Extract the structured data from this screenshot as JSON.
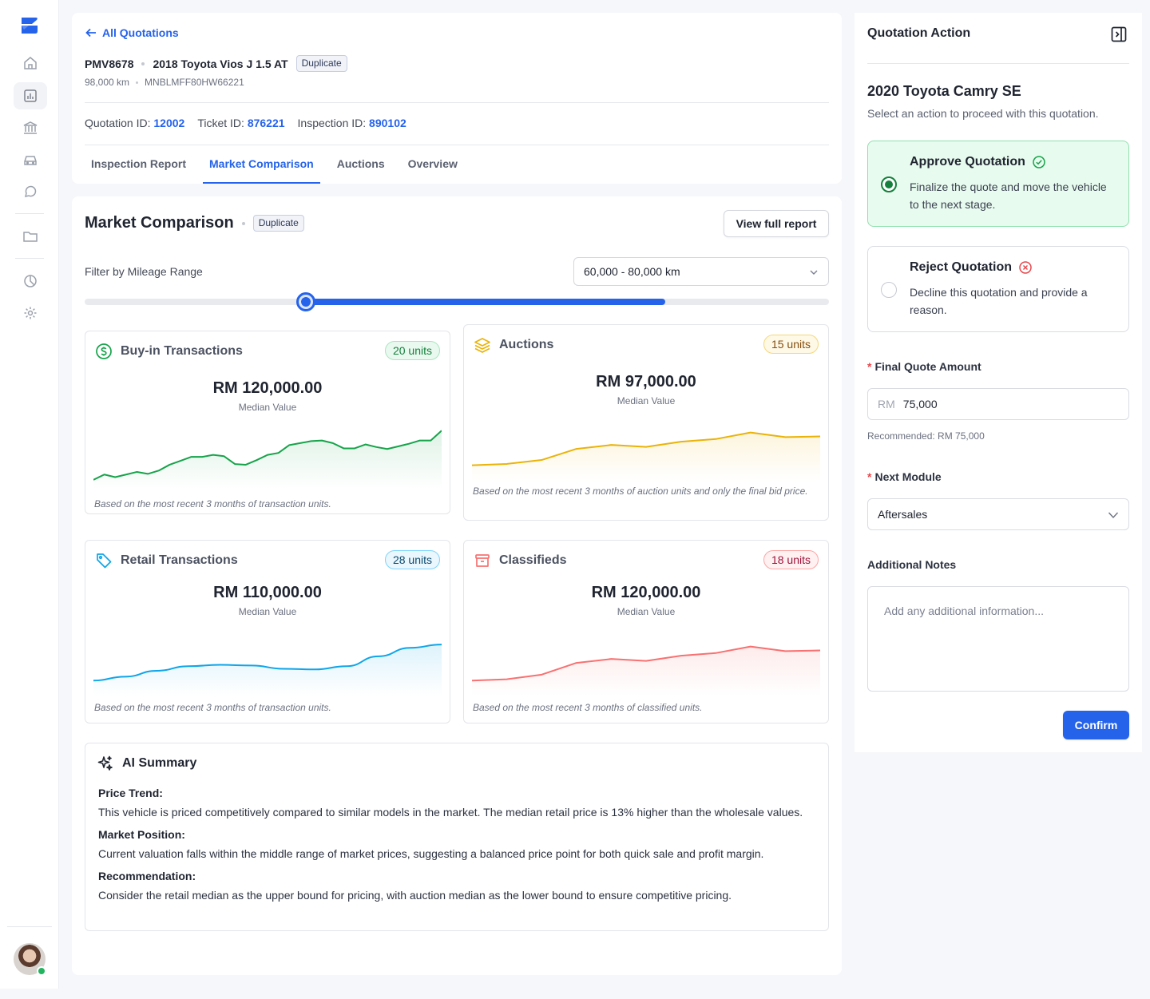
{
  "header": {
    "back_label": "All Quotations",
    "vehicle_code": "PMV8678",
    "vehicle_name": "2018 Toyota Vios J 1.5 AT",
    "badge": "Duplicate",
    "mileage": "98,000 km",
    "vin": "MNBLMFF80HW66221",
    "quotation_id_label": "Quotation ID:",
    "quotation_id": "12002",
    "ticket_id_label": "Ticket ID:",
    "ticket_id": "876221",
    "inspection_id_label": "Inspection ID:",
    "inspection_id": "890102",
    "tabs": [
      {
        "label": "Inspection Report"
      },
      {
        "label": "Market Comparison"
      },
      {
        "label": "Auctions"
      },
      {
        "label": "Overview"
      }
    ],
    "active_tab": "Market Comparison"
  },
  "market": {
    "title": "Market Comparison",
    "badge": "Duplicate",
    "report_button": "View full report",
    "filter_label": "Filter by Mileage Range",
    "mileage_selected": "60,000 - 80,000 km",
    "slider_range": {
      "start_fraction": 0.297,
      "end_fraction": 0.78
    },
    "cards": [
      {
        "title": "Buy-in Transactions",
        "units": "20 units",
        "value": "RM 120,000.00",
        "sub": "Median Value",
        "note": "Based on the most recent 3 months of transaction units.",
        "color": "#16a34a",
        "icon": "dollar-circle-icon",
        "series": [
          10,
          18,
          14,
          18,
          22,
          19,
          24,
          33,
          39,
          45,
          45,
          48,
          46,
          34,
          33,
          40,
          48,
          51,
          63,
          66,
          69,
          70,
          66,
          58,
          58,
          64,
          60,
          57,
          61,
          65,
          70,
          70,
          85
        ]
      },
      {
        "title": "Auctions",
        "units": "15 units",
        "value": "RM 97,000.00",
        "sub": "Median Value",
        "note": "Based on the most recent 3 months of auction units and only the final bid price.",
        "color": "#eab308",
        "icon": "layers-icon",
        "series": [
          20,
          22,
          28,
          45,
          51,
          48,
          56,
          60,
          70,
          63,
          64
        ]
      },
      {
        "title": "Retail Transactions",
        "units": "28 units",
        "value": "RM 110,000.00",
        "sub": "Median Value",
        "note": "Based on the most recent 3 months of transaction units.",
        "color": "#0ea5e9",
        "icon": "tag-icon",
        "series": [
          18,
          24,
          33,
          40,
          42,
          41,
          36,
          35,
          40,
          55,
          68,
          73
        ]
      },
      {
        "title": "Classifieds",
        "units": "18 units",
        "value": "RM 120,000.00",
        "sub": "Median Value",
        "note": "Based on the most recent 3 months of classified units.",
        "color": "#f87171",
        "icon": "archive-box-icon",
        "series": [
          18,
          20,
          27,
          45,
          51,
          48,
          56,
          60,
          70,
          63,
          64
        ]
      }
    ]
  },
  "ai_summary": {
    "title": "AI Summary",
    "sections": [
      {
        "heading": "Price Trend:",
        "text": "This vehicle is priced competitively compared to similar models in the market. The median retail price is 13% higher than the wholesale values."
      },
      {
        "heading": "Market Position:",
        "text": "Current valuation falls within the middle range of market prices, suggesting a balanced price point for both quick sale and profit margin."
      },
      {
        "heading": "Recommendation:",
        "text": "Consider the retail median as the upper bound for pricing, with auction median as the lower bound to ensure competitive pricing."
      }
    ]
  },
  "panel": {
    "title": "Quotation Action",
    "vehicle": "2020 Toyota Camry SE",
    "description": "Select an action to proceed with this quotation.",
    "approve_title": "Approve Quotation",
    "approve_desc": "Finalize the quote and move the vehicle to the next stage.",
    "reject_title": "Reject Quotation",
    "reject_desc": "Decline this quotation and provide a reason.",
    "selected_action": "approve",
    "amount_label": "Final Quote Amount",
    "currency": "RM",
    "amount_value": "75,000",
    "recommended": "Recommended: RM 75,000",
    "module_label": "Next Module",
    "module_value": "Aftersales",
    "notes_label": "Additional Notes",
    "notes_placeholder": "Add any additional information...",
    "confirm_label": "Confirm"
  },
  "colors": {
    "accent": "#2563eb",
    "approve_bg": "#e8fbef",
    "required": "#e5484d"
  }
}
